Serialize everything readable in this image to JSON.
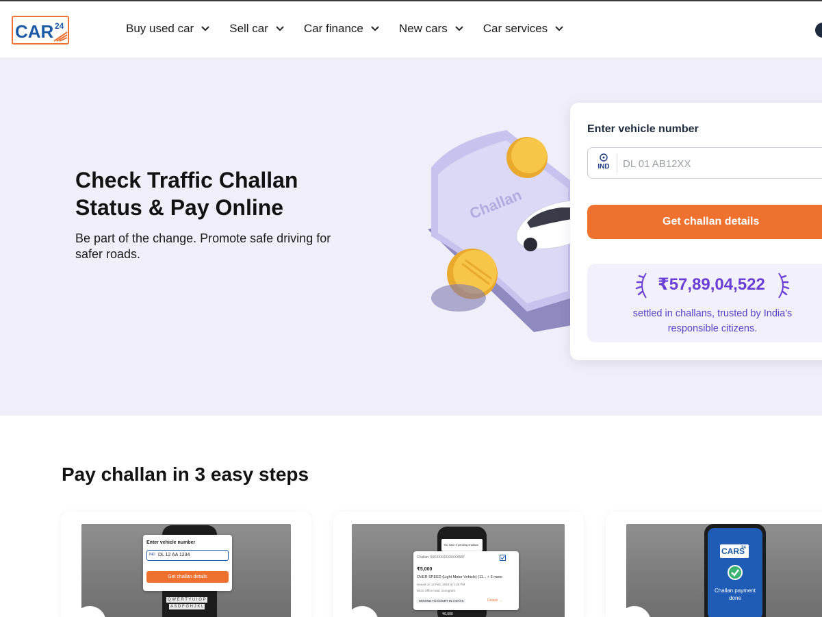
{
  "header": {
    "logo_text": "CARS",
    "logo_num": "24",
    "nav": [
      {
        "label": "Buy used car"
      },
      {
        "label": "Sell car"
      },
      {
        "label": "Car finance"
      },
      {
        "label": "New cars"
      },
      {
        "label": "Car services"
      }
    ]
  },
  "hero": {
    "title": "Check Traffic Challan Status & Pay Online",
    "subtitle": "Be part of the change. Promote safe driving for safer roads.",
    "illustration_word": "Challan"
  },
  "form": {
    "label": "Enter vehicle number",
    "country_code": "IND",
    "placeholder": "DL 01 AB12XX",
    "value": "",
    "cta_label": "Get challan details",
    "stat_amount": "₹57,89,04,522",
    "stat_caption": "settled in challans, trusted by India's responsible citizens."
  },
  "steps": {
    "title": "Pay challan in 3 easy steps",
    "step1": {
      "panel_label": "Enter vehicle number",
      "ind": "IND",
      "plate": "DL  12  AA  1234",
      "button": "Get challan details",
      "keys_row1": "Q W E R T Y U I O P",
      "keys_row2": "A S D F G H J K L"
    },
    "step2": {
      "pending": "You have 6 pending challans",
      "challan_no": "Challan: INXXXXXXXXXXX587",
      "amount": "₹5,000",
      "offence": "OVER SPEED (Light Motor Vehicle) (11... + 2 more",
      "issued": "Issued on 12 Feb, 2024 at 1:40 PM",
      "location": "MCD Office road, Gurugram",
      "status": "MOVING TO COURT IN 3 DAYS",
      "details": "Details  →",
      "amount2": "₹6,500"
    },
    "step3": {
      "logo": "CARS",
      "logo_num": "24",
      "text": "Challan payment done"
    }
  },
  "colors": {
    "accent": "#ef7130",
    "brand_blue": "#1b5aa6",
    "stat_purple": "#6b3fd6",
    "hero_bg": "#f0eff9"
  },
  "icons": [
    "chevron-down-icon",
    "profile-icon",
    "india-emblem-icon",
    "laurel-icon",
    "check-icon"
  ]
}
